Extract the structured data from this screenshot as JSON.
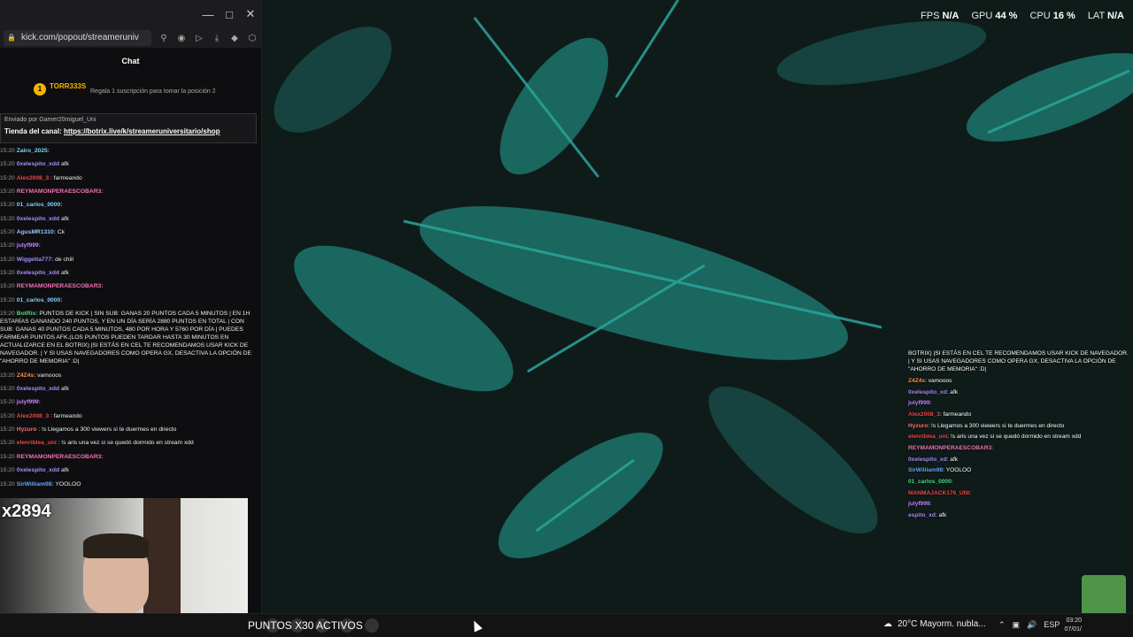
{
  "overlay_stats": [
    {
      "label": "FPS",
      "value": "N/A"
    },
    {
      "label": "GPU",
      "value": "44 %"
    },
    {
      "label": "CPU",
      "value": "16 %"
    },
    {
      "label": "LAT",
      "value": "N/A"
    }
  ],
  "browser": {
    "url": "kick.com/popout/streameruniv",
    "chat_title": "Chat"
  },
  "sub_banner": {
    "badge": "1",
    "user": "TORR333S",
    "info": "Regala 1 suscripción para tomar la posición 2"
  },
  "pinned": {
    "by": "Enviado por Gamer20miguel_Uni",
    "shop_label": "Tienda del canal:",
    "shop_link": "https://botrix.live/k/streameruniversitario/shop"
  },
  "chat": [
    {
      "t": "15:20",
      "u": "Zairo_2025:",
      "c": "#7dd3fc",
      "m": ""
    },
    {
      "t": "15:20",
      "u": "0xelespito_xdd",
      "c": "#a78bfa",
      "m": "afk"
    },
    {
      "t": "15:20",
      "u": "Alex2008_3",
      "c": "#ef4444",
      "m": ": farmeando"
    },
    {
      "t": "15:20",
      "u": "REYMAMONPERAESCOBAR3:",
      "c": "#f472b6",
      "m": ""
    },
    {
      "t": "15:20",
      "u": "01_carlos_0000:",
      "c": "#7dd3fc",
      "m": ""
    },
    {
      "t": "15:20",
      "u": "0xelespito_xdd",
      "c": "#a78bfa",
      "m": "afk"
    },
    {
      "t": "15:20",
      "u": "AgusMR1310:",
      "c": "#93c5fd",
      "m": "Ck"
    },
    {
      "t": "15:20",
      "u": "julyf999:",
      "c": "#c084fc",
      "m": ""
    },
    {
      "t": "15:20",
      "u": "Wiggetta777:",
      "c": "#a78bfa",
      "m": "de chill"
    },
    {
      "t": "15:20",
      "u": "0xelespito_xdd",
      "c": "#a78bfa",
      "m": "afk"
    },
    {
      "t": "15:20",
      "u": "REYMAMONPERAESCOBAR3:",
      "c": "#f472b6",
      "m": ""
    },
    {
      "t": "15:20",
      "u": "01_carlos_0000:",
      "c": "#7dd3fc",
      "m": ""
    },
    {
      "t": "15:20",
      "u": "BotRix:",
      "c": "#4ade80",
      "m": "PUNTOS DE KICK | SIN SUB: GANAS 20 PUNTOS CADA 5 MINUTOS | EN 1H ESTARÍAS GANANDO 240 PUNTOS, Y EN UN DÍA SERÍA 2880 PUNTOS EN TOTAL | CON SUB: GANAS 40 PUNTOS CADA 5 MINUTOS, 480 POR HORA Y 5760 POR DÍA | PUEDES FARMEAR PUNTOS AFK.(LOS PUNTOS PUEDEN TARDAR HASTA 30 MINUTOS EN ACTUALIZARCE EN EL BOTRIX) |SI ESTÁS EN CEL TE RECOMENDAMOS USAR KICK DE NAVEGADOR. | Y SI USAS NAVEGADORES COMO OPERA GX, DESACTIVA LA OPCIÓN DE \"AHORRO DE MEMORIA\" :D|"
    },
    {
      "t": "15:20",
      "u": "Z4Z4s:",
      "c": "#fb923c",
      "m": "vamooos"
    },
    {
      "t": "15:20",
      "u": "0xelespito_xdd",
      "c": "#a78bfa",
      "m": "afk"
    },
    {
      "t": "15:20",
      "u": "julyf999:",
      "c": "#c084fc",
      "m": ""
    },
    {
      "t": "15:20",
      "u": "Alex2008_3",
      "c": "#ef4444",
      "m": ": farmeando"
    },
    {
      "t": "15:20",
      "u": "Hyzuro",
      "c": "#f87171",
      "m": ": !s Llegamos a 300 viewers si te duermes en directo"
    },
    {
      "t": "15:20",
      "u": "elenriblea_uni",
      "c": "#ef4444",
      "m": ": !s aris una vez si se quedó dormido en stream xdd"
    },
    {
      "t": "15:20",
      "u": "REYMAMONPERAESCOBAR3:",
      "c": "#f472b6",
      "m": ""
    },
    {
      "t": "15:20",
      "u": "0xelespito_xdd",
      "c": "#a78bfa",
      "m": "afk"
    },
    {
      "t": "15:20",
      "u": "SirWilliam98:",
      "c": "#60a5fa",
      "m": "YOOLOO"
    }
  ],
  "cam_counter": "x2894",
  "overlay_chat": [
    {
      "u": "",
      "c": "#fff",
      "m": "BOTRIX) |SI ESTÁS EN CEL TE RECOMENDAMOS USAR KICK DE NAVEGADOR. | Y SI USAS NAVEGADORES COMO OPERA GX, DESACTIVA LA OPCIÓN DE \"AHORRO DE MEMORIA\" :D|"
    },
    {
      "u": "Z4Z4s",
      "c": "#fb923c",
      "m": ": vamooos"
    },
    {
      "u": "0xelespito_xd",
      "c": "#a78bfa",
      "m": ": afk"
    },
    {
      "u": "julyf999",
      "c": "#c084fc",
      "m": ":"
    },
    {
      "u": "Alex2008_3",
      "c": "#ef4444",
      "m": ": farmeando"
    },
    {
      "u": "Hyzuro",
      "c": "#f87171",
      "m": ": !s Llegamos a 300 viewers si te duermes en directo"
    },
    {
      "u": "elenriblea_uni",
      "c": "#ef4444",
      "m": ": !s aris una vez si se quedó dormido en stream xdd"
    },
    {
      "u": "REYMAMONPERAESCOBAR3",
      "c": "#f472b6",
      "m": ":"
    },
    {
      "u": "0xelespito_xd",
      "c": "#a78bfa",
      "m": ": afk"
    },
    {
      "u": "SirWilliam98",
      "c": "#60a5fa",
      "m": ": YOOLOO"
    },
    {
      "u": "01_carlos_0000",
      "c": "#4ade80",
      "m": ":"
    },
    {
      "u": "MANMAJACK176_UNI",
      "c": "#ef4444",
      "m": ":"
    },
    {
      "u": "julyf999",
      "c": "#c084fc",
      "m": ":"
    },
    {
      "u": "espito_xd",
      "c": "#a78bfa",
      "m": ": afk"
    }
  ],
  "taskbar": {
    "ticker": "PUNTOS X30 ACTIVOS",
    "weather": "20°C  Mayorm. nubla...",
    "lang": "ESP",
    "time": "03:20",
    "date": "07/01/"
  }
}
